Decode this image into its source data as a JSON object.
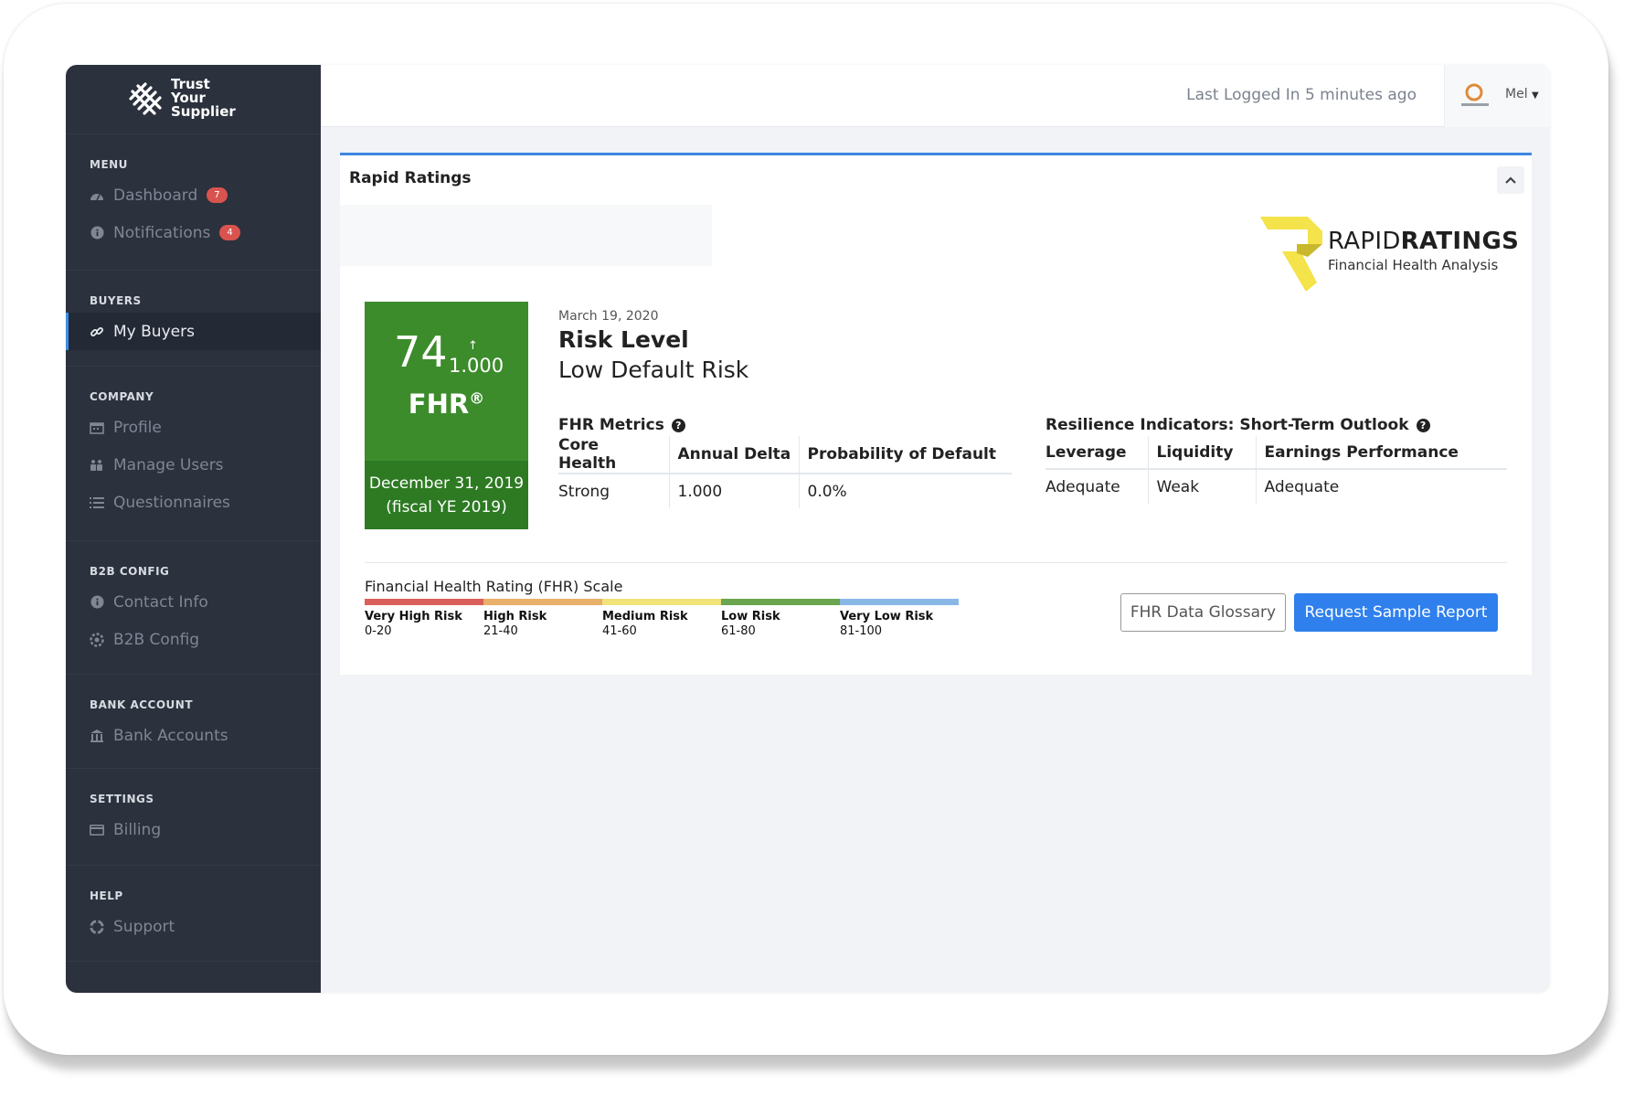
{
  "brand": {
    "line1": "Trust",
    "line2": "Your",
    "line3": "Supplier"
  },
  "sidebar": {
    "sections": [
      {
        "label": "MENU",
        "items": [
          {
            "label": "Dashboard",
            "icon": "dashboard-gauge-icon",
            "badge": "7"
          },
          {
            "label": "Notifications",
            "icon": "info-circle-icon",
            "badge": "4"
          }
        ]
      },
      {
        "label": "BUYERS",
        "items": [
          {
            "label": "My Buyers",
            "icon": "link-icon",
            "active": true
          }
        ]
      },
      {
        "label": "COMPANY",
        "items": [
          {
            "label": "Profile",
            "icon": "calendar-icon"
          },
          {
            "label": "Manage Users",
            "icon": "users-icon"
          },
          {
            "label": "Questionnaires",
            "icon": "list-icon"
          }
        ]
      },
      {
        "label": "B2B CONFIG",
        "items": [
          {
            "label": "Contact Info",
            "icon": "info-circle-icon"
          },
          {
            "label": "B2B Config",
            "icon": "gear-icon"
          }
        ]
      },
      {
        "label": "BANK ACCOUNT",
        "items": [
          {
            "label": "Bank Accounts",
            "icon": "bank-icon"
          }
        ]
      },
      {
        "label": "SETTINGS",
        "items": [
          {
            "label": "Billing",
            "icon": "credit-card-icon"
          }
        ]
      },
      {
        "label": "HELP",
        "items": [
          {
            "label": "Support",
            "icon": "lifebuoy-icon"
          }
        ]
      }
    ]
  },
  "topbar": {
    "last_logged": "Last Logged In 5 minutes ago",
    "user_name": "Mel"
  },
  "card": {
    "title": "Rapid Ratings",
    "logo_brand_light": "RAPID",
    "logo_brand_bold": "RATINGS",
    "logo_subtitle": "Financial Health Analysis",
    "fhr": {
      "score": "74",
      "delta": "1.000",
      "arrow": "↑",
      "label": "FHR",
      "reg": "®",
      "date_line1": "December 31, 2019",
      "date_line2": "(fiscal YE 2019)"
    },
    "rating_date": "March 19, 2020",
    "risk_title": "Risk Level",
    "risk_value": "Low Default Risk",
    "fhr_metrics": {
      "heading": "FHR Metrics",
      "columns": [
        "Core Health",
        "Annual Delta",
        "Probability of Default"
      ],
      "values": [
        "Strong",
        "1.000",
        "0.0%"
      ]
    },
    "resilience": {
      "heading": "Resilience Indicators: Short-Term Outlook",
      "columns": [
        "Leverage",
        "Liquidity",
        "Earnings Performance"
      ],
      "values": [
        "Adequate",
        "Weak",
        "Adequate"
      ]
    },
    "scale": {
      "title": "Financial Health Rating (FHR) Scale",
      "bands": [
        {
          "label": "Very High Risk",
          "range": "0-20",
          "color": "#d9605a"
        },
        {
          "label": "High Risk",
          "range": "21-40",
          "color": "#e8b068"
        },
        {
          "label": "Medium Risk",
          "range": "41-60",
          "color": "#f2e27a"
        },
        {
          "label": "Low Risk",
          "range": "61-80",
          "color": "#6aa54f"
        },
        {
          "label": "Very Low Risk",
          "range": "81-100",
          "color": "#8ab8e6"
        }
      ]
    },
    "buttons": {
      "glossary": "FHR Data Glossary",
      "request": "Request Sample Report"
    }
  }
}
